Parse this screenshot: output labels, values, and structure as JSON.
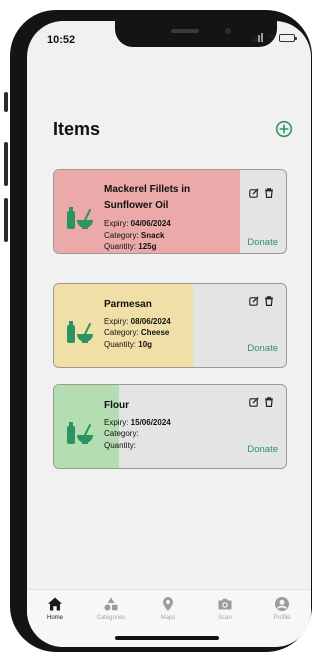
{
  "status_bar": {
    "time": "10:52"
  },
  "header": {
    "title": "Items",
    "add_icon": "plus-circle-icon"
  },
  "colors": {
    "accent": "#2b9462",
    "expired": "#eba9a9",
    "expiring": "#f0e0a8",
    "fresh": "#b4deb2",
    "card_bg": "#e4e4e4"
  },
  "items": [
    {
      "name": "Mackerel Fillets in Sunflower Oil",
      "expiry_label": "Expiry: ",
      "expiry": "04/06/2024",
      "category_label": "Category: ",
      "category": "Snack",
      "quantity_label": "Quantity: ",
      "quantity": "125g",
      "freshness_fill": 0.8,
      "status_color": "#eba9a9",
      "donate": "Donate",
      "icon": "jar-bowl-icon"
    },
    {
      "name": "Parmesan",
      "expiry_label": "Expiry: ",
      "expiry": "08/06/2024",
      "category_label": "Category: ",
      "category": "Cheese",
      "quantity_label": "Quantity: ",
      "quantity": "10g",
      "freshness_fill": 0.6,
      "status_color": "#f0e0a8",
      "donate": "Donate",
      "icon": "jar-bowl-icon"
    },
    {
      "name": "Flour",
      "expiry_label": "Expiry: ",
      "expiry": "15/06/2024",
      "category_label": "Category:",
      "category": "",
      "quantity_label": "Quantity:",
      "quantity": "",
      "freshness_fill": 0.28,
      "status_color": "#b4deb2",
      "donate": "Donate",
      "icon": "jar-bowl-icon"
    }
  ],
  "tabs": [
    {
      "label": "Home",
      "icon": "home-icon",
      "active": true
    },
    {
      "label": "Categories",
      "icon": "shapes-icon",
      "active": false
    },
    {
      "label": "Maps",
      "icon": "map-pin-icon",
      "active": false
    },
    {
      "label": "Scan",
      "icon": "camera-icon",
      "active": false
    },
    {
      "label": "Profile",
      "icon": "profile-icon",
      "active": false
    }
  ]
}
